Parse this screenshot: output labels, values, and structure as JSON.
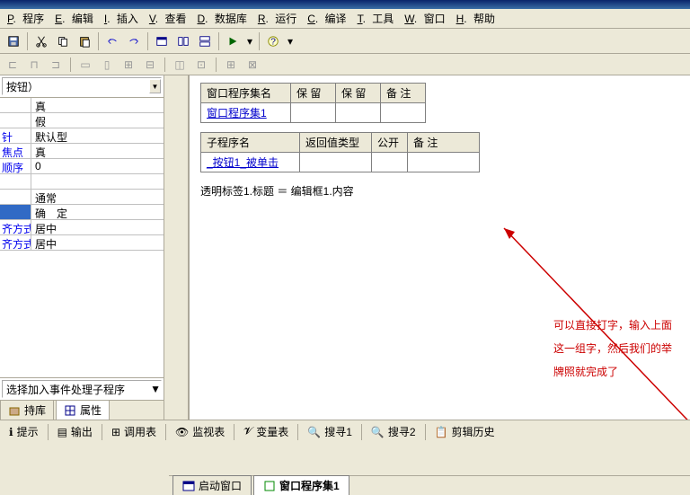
{
  "menu": {
    "program": "程序",
    "edit": "编辑",
    "insert": "插入",
    "view": "查看",
    "database": "数据库",
    "run": "运行",
    "compile": "编译",
    "tools": "工具",
    "window": "窗口",
    "help": "帮助",
    "keys": {
      "program": "P",
      "edit": "E",
      "insert": "I",
      "view": "V",
      "database": "D",
      "run": "R",
      "compile": "C",
      "tools": "T",
      "window": "W",
      "help": "H"
    }
  },
  "left": {
    "combo": "按钮）",
    "props": [
      {
        "label": "",
        "value": "真"
      },
      {
        "label": "",
        "value": "假"
      },
      {
        "label": "针",
        "value": "默认型"
      },
      {
        "label": "焦点",
        "value": "真"
      },
      {
        "label": "顺序",
        "value": "0"
      },
      {
        "label": "",
        "value": ""
      },
      {
        "label": "",
        "value": "通常"
      },
      {
        "label": "",
        "value": "确　定",
        "selected": true
      },
      {
        "label": "齐方式",
        "value": "居中"
      },
      {
        "label": "齐方式",
        "value": "居中"
      }
    ],
    "event_placeholder": "选择加入事件处理子程序",
    "tabs": {
      "support": "持库",
      "property": "属性"
    }
  },
  "editor": {
    "table1": {
      "headers": [
        "窗口程序集名",
        "保 留",
        "保 留",
        "备 注"
      ],
      "row": "窗口程序集1"
    },
    "table2": {
      "headers": [
        "子程序名",
        "返回值类型",
        "公开",
        "备 注"
      ],
      "row": "_按钮1_被单击"
    },
    "code": "透明标签1.标题 ＝ 编辑框1.内容",
    "tabs": {
      "startup": "启动窗口",
      "assembly": "窗口程序集1"
    }
  },
  "annotation": {
    "line1": "可以直接打字，输入上面",
    "line2": "这一组字，然后我们的举",
    "line3": "牌照就完成了"
  },
  "bottom": {
    "tip": "提示",
    "output": "输出",
    "call": "调用表",
    "watch": "监视表",
    "var": "变量表",
    "find1": "搜寻1",
    "find2": "搜寻2",
    "clip": "剪辑历史"
  }
}
